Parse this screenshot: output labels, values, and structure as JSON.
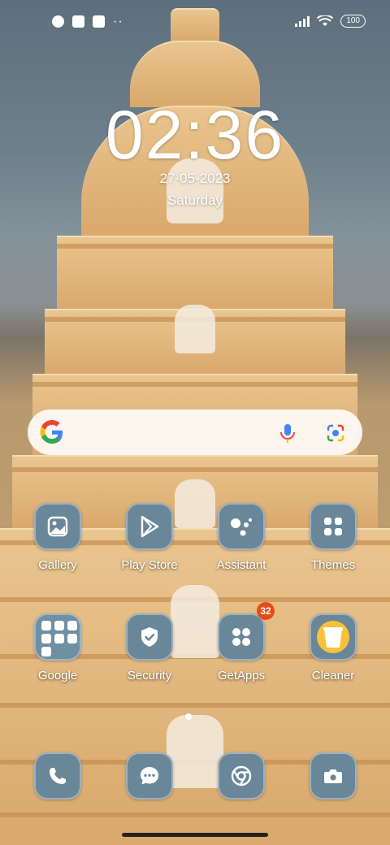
{
  "status": {
    "battery": "100",
    "more": "··"
  },
  "lockscreen": {
    "time": "02:36",
    "date": "27-05-2023",
    "day": "Saturday"
  },
  "search": {
    "google": "G"
  },
  "apps_row1": [
    {
      "label": "Gallery"
    },
    {
      "label": "Play Store"
    },
    {
      "label": "Assistant"
    },
    {
      "label": "Themes"
    }
  ],
  "apps_row2": [
    {
      "label": "Google"
    },
    {
      "label": "Security"
    },
    {
      "label": "GetApps",
      "badge": "32"
    },
    {
      "label": "Cleaner"
    }
  ],
  "icons": {
    "dock": [
      "phone-icon",
      "messages-icon",
      "chrome-icon",
      "camera-icon"
    ]
  },
  "colors": {
    "icon_bg": "#6a8799",
    "badge": "#e84b16"
  }
}
